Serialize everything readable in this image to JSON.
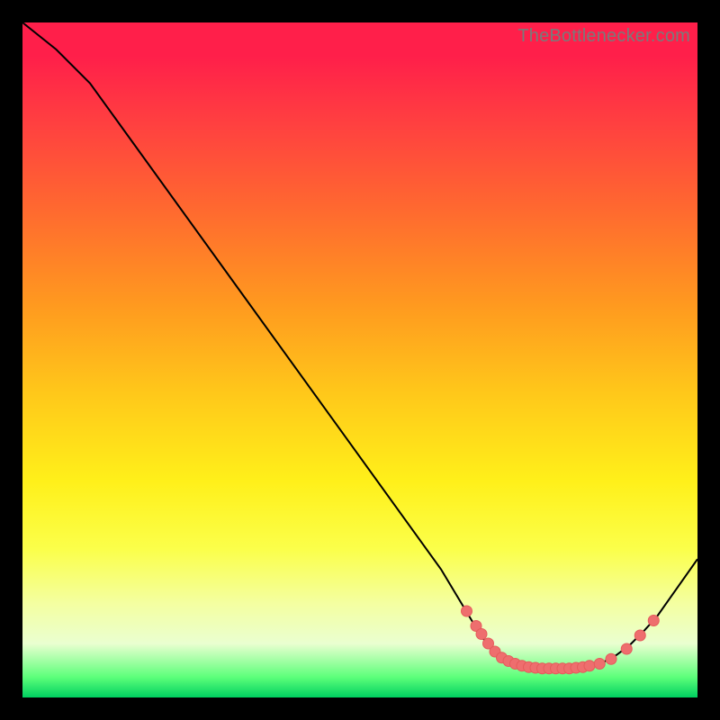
{
  "watermark": "TheBottlenecker.com",
  "colors": {
    "curve_stroke": "#000000",
    "marker_fill": "#ee6e6e",
    "marker_stroke": "#e55b5b"
  },
  "chart_data": {
    "type": "line",
    "title": "",
    "xlabel": "",
    "ylabel": "",
    "xlim": [
      0,
      100
    ],
    "ylim": [
      0,
      100
    ],
    "curve": [
      {
        "x": 0,
        "y": 100
      },
      {
        "x": 5,
        "y": 96
      },
      {
        "x": 10,
        "y": 91
      },
      {
        "x": 62,
        "y": 19
      },
      {
        "x": 65,
        "y": 14
      },
      {
        "x": 68,
        "y": 9
      },
      {
        "x": 70,
        "y": 6.7
      },
      {
        "x": 72,
        "y": 5.4
      },
      {
        "x": 74,
        "y": 4.6
      },
      {
        "x": 76,
        "y": 4.3
      },
      {
        "x": 78,
        "y": 4.3
      },
      {
        "x": 80,
        "y": 4.3
      },
      {
        "x": 82,
        "y": 4.3
      },
      {
        "x": 84,
        "y": 4.6
      },
      {
        "x": 86,
        "y": 5.2
      },
      {
        "x": 88,
        "y": 6.3
      },
      {
        "x": 90,
        "y": 7.8
      },
      {
        "x": 92,
        "y": 9.8
      },
      {
        "x": 94,
        "y": 12.0
      },
      {
        "x": 100,
        "y": 20.5
      }
    ],
    "markers": [
      {
        "x": 65.8,
        "y": 12.8
      },
      {
        "x": 67.2,
        "y": 10.6
      },
      {
        "x": 68.0,
        "y": 9.4
      },
      {
        "x": 69.0,
        "y": 8.0
      },
      {
        "x": 70.0,
        "y": 6.8
      },
      {
        "x": 71.0,
        "y": 5.9
      },
      {
        "x": 72.0,
        "y": 5.4
      },
      {
        "x": 73.0,
        "y": 5.0
      },
      {
        "x": 74.0,
        "y": 4.7
      },
      {
        "x": 75.0,
        "y": 4.5
      },
      {
        "x": 76.0,
        "y": 4.4
      },
      {
        "x": 77.0,
        "y": 4.3
      },
      {
        "x": 78.0,
        "y": 4.3
      },
      {
        "x": 79.0,
        "y": 4.3
      },
      {
        "x": 80.0,
        "y": 4.3
      },
      {
        "x": 81.0,
        "y": 4.3
      },
      {
        "x": 82.0,
        "y": 4.4
      },
      {
        "x": 83.0,
        "y": 4.5
      },
      {
        "x": 84.0,
        "y": 4.7
      },
      {
        "x": 85.5,
        "y": 5.0
      },
      {
        "x": 87.2,
        "y": 5.7
      },
      {
        "x": 89.5,
        "y": 7.2
      },
      {
        "x": 91.5,
        "y": 9.2
      },
      {
        "x": 93.5,
        "y": 11.4
      }
    ]
  }
}
